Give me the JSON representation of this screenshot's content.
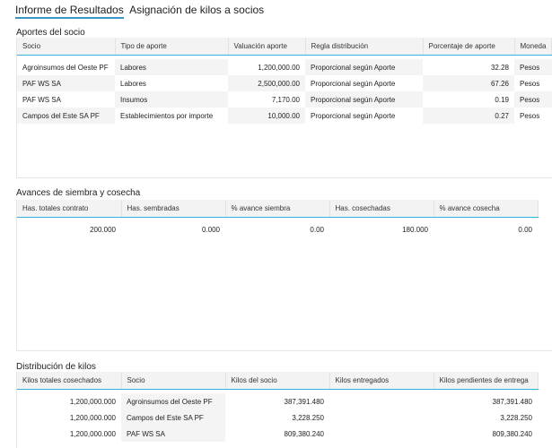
{
  "tabs": [
    {
      "label": "Informe de Resultados"
    },
    {
      "label": "Asignación de kilos a socios"
    }
  ],
  "aportes": {
    "title": "Aportes del socio",
    "columns": [
      "Socio",
      "Tipo de aporte",
      "Valuación aporte",
      "Regla distribución",
      "Porcentaje de aporte",
      "Moneda"
    ],
    "rows": [
      [
        "Agroinsumos del Oeste PF",
        "Labores",
        "1,200,000.00",
        "Proporcional según Aporte",
        "32.28",
        "Pesos"
      ],
      [
        "PAF WS SA",
        "Labores",
        "2,500,000.00",
        "Proporcional según Aporte",
        "67.26",
        "Pesos"
      ],
      [
        "PAF WS SA",
        "Insumos",
        "7,170.00",
        "Proporcional según Aporte",
        "0.19",
        "Pesos"
      ],
      [
        "Campos del Este SA PF",
        "Establecimientos por importe",
        "10,000.00",
        "Proporcional según Aporte",
        "0.27",
        "Pesos"
      ]
    ]
  },
  "avances": {
    "title": "Avances de siembra y cosecha",
    "columns": [
      "Has. totales contrato",
      "Has. sembradas",
      "% avance siembra",
      "Has. cosechadas",
      "% avance cosecha"
    ],
    "rows": [
      [
        "200.000",
        "0.000",
        "0.00",
        "180.000",
        "0.00"
      ]
    ]
  },
  "distribucion": {
    "title": "Distribución de kilos",
    "columns": [
      "Kilos totales cosechados",
      "Socio",
      "Kilos del socio",
      "Kilos entregados",
      "Kilos pendientes de entrega"
    ],
    "rows": [
      [
        "1,200,000.000",
        "Agroinsumos del Oeste PF",
        "387,391.480",
        "",
        "387,391.480"
      ],
      [
        "1,200,000.000",
        "Campos del Este SA PF",
        "3,228.250",
        "",
        "3,228.250"
      ],
      [
        "1,200,000.000",
        "PAF WS SA",
        "809,380.240",
        "",
        "809,380.240"
      ]
    ]
  }
}
